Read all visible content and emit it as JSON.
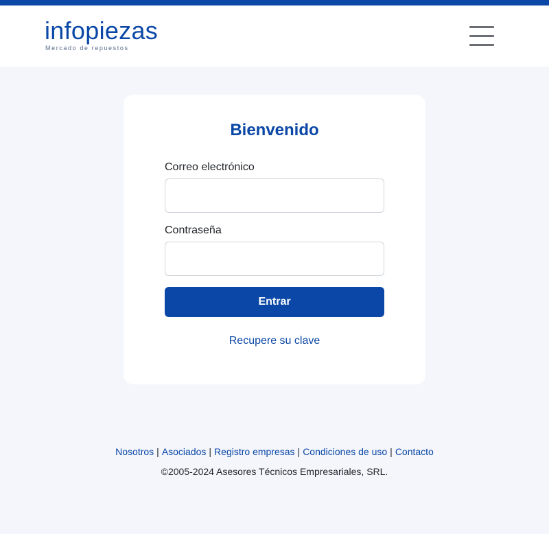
{
  "header": {
    "logo_word": "infopiezas",
    "logo_tagline": "Mercado de repuestos",
    "menu_icon": "hamburger-menu-icon"
  },
  "colors": {
    "brand": "#0a47a6",
    "page_background": "#f4f6fb",
    "card_background": "#ffffff"
  },
  "login": {
    "title": "Bienvenido",
    "email_label": "Correo electrónico",
    "email_value": "",
    "password_label": "Contraseña",
    "password_value": "",
    "submit_label": "Entrar",
    "recover_label": "Recupere su clave"
  },
  "footer": {
    "links": [
      "Nosotros",
      "Asociados",
      "Registro empresas",
      "Condiciones de uso",
      "Contacto"
    ],
    "separator": "|",
    "copyright": "©2005-2024 Asesores Técnicos Empresariales, SRL."
  }
}
